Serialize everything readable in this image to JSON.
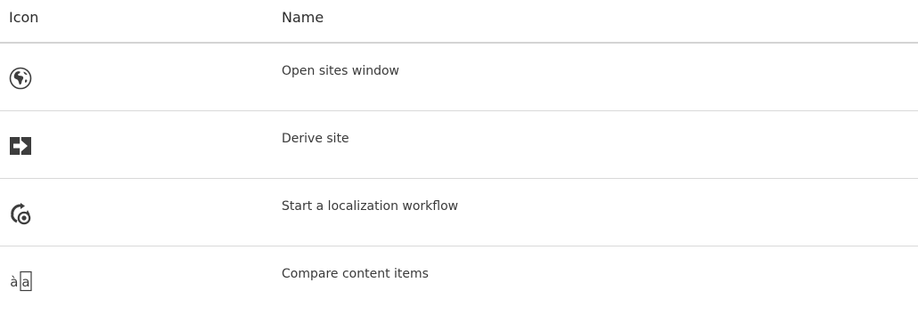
{
  "table": {
    "headers": {
      "icon": "Icon",
      "name": "Name"
    },
    "rows": [
      {
        "icon": "globe-icon",
        "name": "Open sites window"
      },
      {
        "icon": "derive-site-icon",
        "name": "Derive site"
      },
      {
        "icon": "localization-workflow-icon",
        "name": "Start a localization workflow"
      },
      {
        "icon": "compare-content-icon",
        "name": "Compare content items",
        "icon_text": "àa"
      }
    ]
  },
  "colors": {
    "icon_dark": "#3d3d3d",
    "divider": "#d9d9d9",
    "header_divider": "#d4d4d4"
  }
}
